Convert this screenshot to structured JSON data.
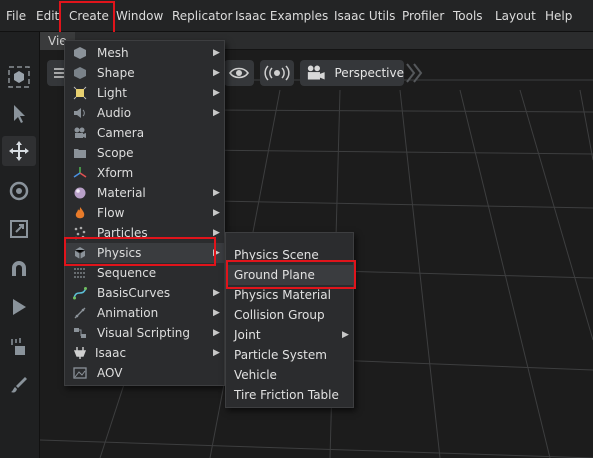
{
  "menubar": {
    "items": [
      "File",
      "Edit",
      "Create",
      "Window",
      "Replicator",
      "Isaac Examples",
      "Isaac Utils",
      "Profiler",
      "Tools",
      "Layout",
      "Help"
    ]
  },
  "viewport": {
    "tab_label": "Vie",
    "camera_label": "Perspective"
  },
  "create_menu": {
    "items": [
      {
        "label": "Mesh",
        "icon": "mesh-icon",
        "submenu": true
      },
      {
        "label": "Shape",
        "icon": "shape-icon",
        "submenu": true
      },
      {
        "label": "Light",
        "icon": "light-icon",
        "submenu": true
      },
      {
        "label": "Audio",
        "icon": "audio-icon",
        "submenu": true
      },
      {
        "label": "Camera",
        "icon": "camera-icon",
        "submenu": false
      },
      {
        "label": "Scope",
        "icon": "scope-folder-icon",
        "submenu": false
      },
      {
        "label": "Xform",
        "icon": "xform-icon",
        "submenu": false
      },
      {
        "label": "Material",
        "icon": "material-icon",
        "submenu": true
      },
      {
        "label": "Flow",
        "icon": "flow-icon",
        "submenu": true
      },
      {
        "label": "Particles",
        "icon": "particles-icon",
        "submenu": true
      },
      {
        "label": "Physics",
        "icon": "physics-icon",
        "submenu": true
      },
      {
        "label": "Sequence",
        "icon": "sequence-icon",
        "submenu": false
      },
      {
        "label": "BasisCurves",
        "icon": "basis-curves-icon",
        "submenu": true
      },
      {
        "label": "Animation",
        "icon": "animation-icon",
        "submenu": true
      },
      {
        "label": "Visual Scripting",
        "icon": "visual-scripting-icon",
        "submenu": true
      },
      {
        "label": "Isaac",
        "icon": "isaac-icon",
        "submenu": true
      },
      {
        "label": "AOV",
        "icon": "aov-icon",
        "submenu": false
      }
    ]
  },
  "physics_submenu": {
    "items": [
      {
        "label": "Physics Scene",
        "submenu": false
      },
      {
        "label": "Ground Plane",
        "submenu": false
      },
      {
        "label": "Physics Material",
        "submenu": false
      },
      {
        "label": "Collision Group",
        "submenu": false
      },
      {
        "label": "Joint",
        "submenu": true
      },
      {
        "label": "Particle System",
        "submenu": false
      },
      {
        "label": "Vehicle",
        "submenu": false
      },
      {
        "label": "Tire Friction Table",
        "submenu": false
      }
    ]
  },
  "colors": {
    "highlight_border": "#e0141b",
    "menu_bg": "#2b2c2e",
    "menubar_bg": "#232425"
  }
}
